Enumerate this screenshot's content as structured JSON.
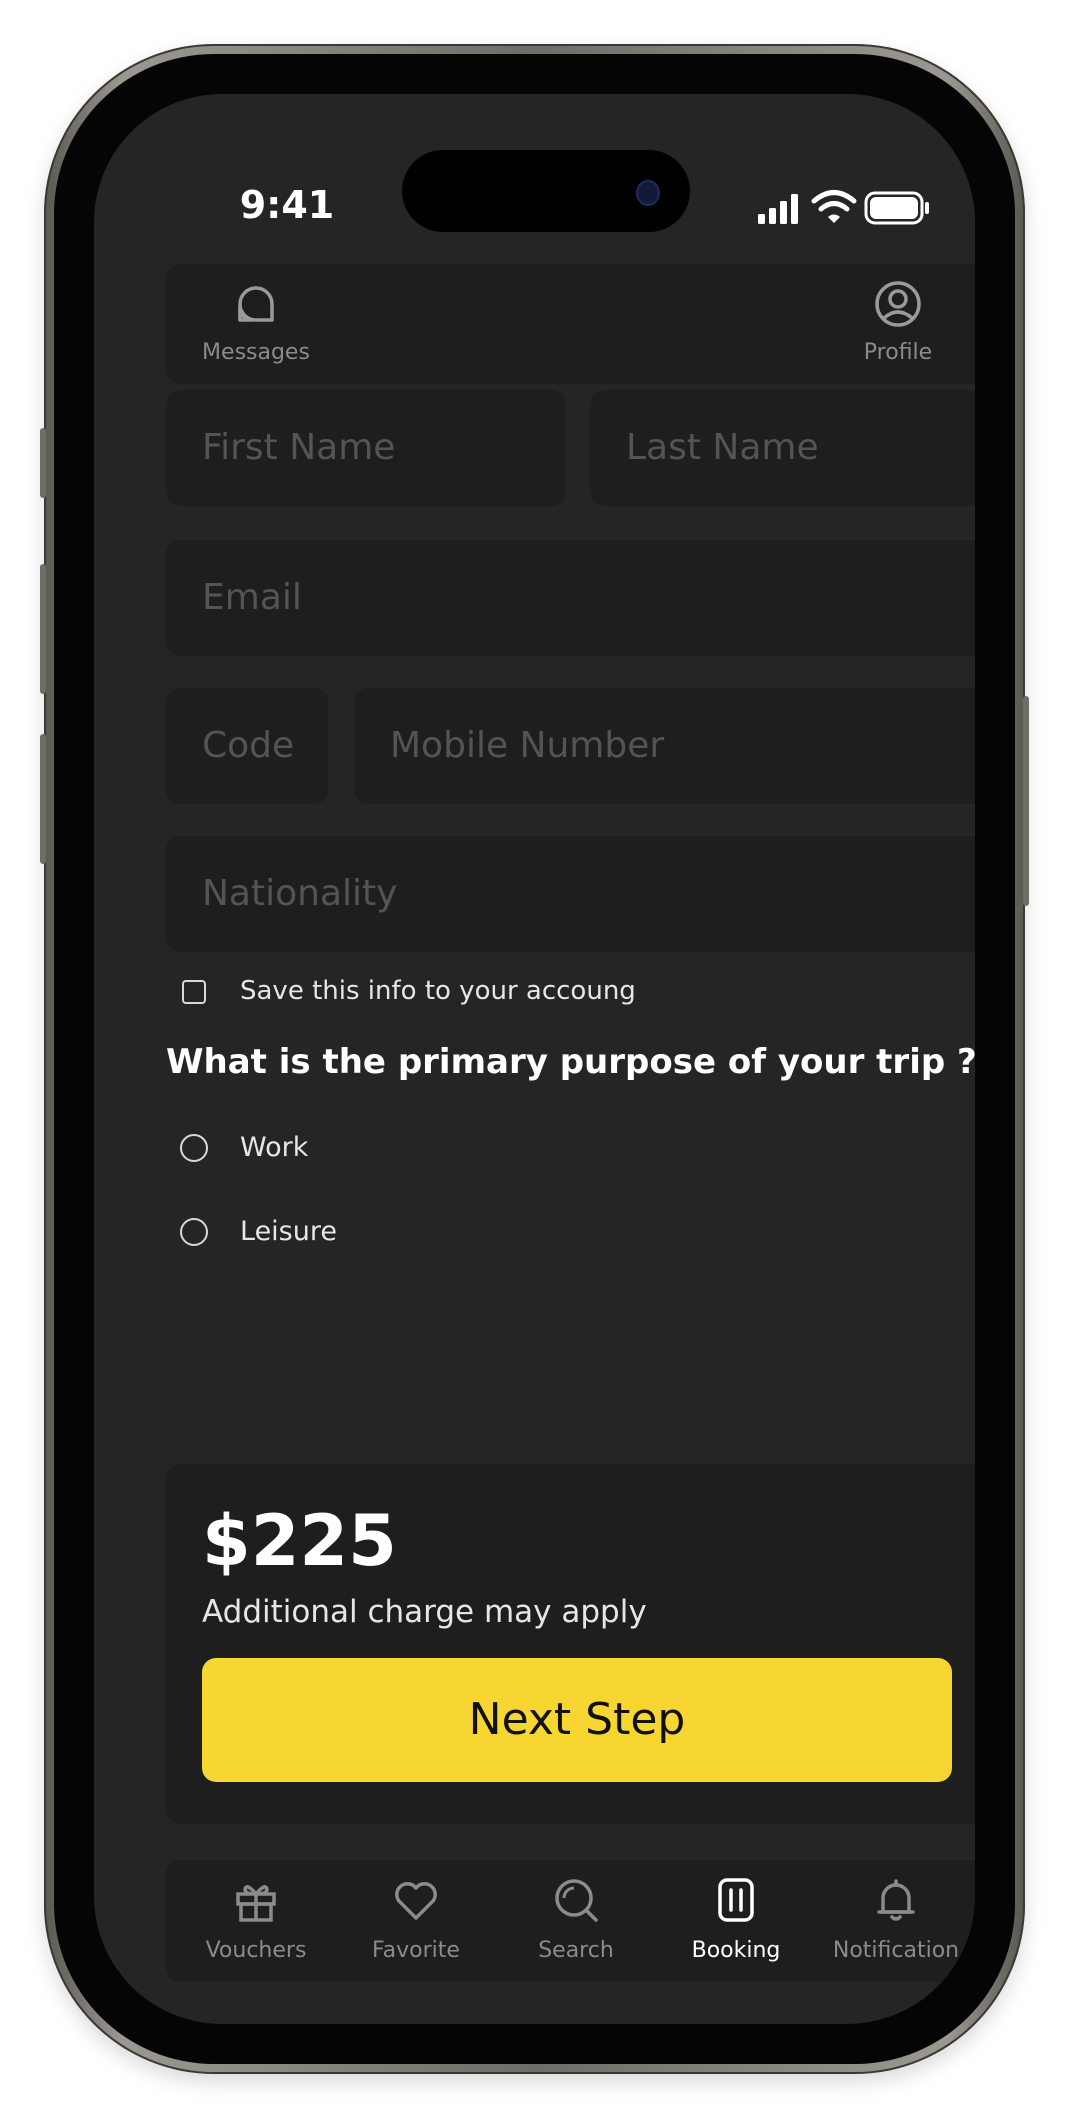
{
  "status_bar": {
    "time": "9:41"
  },
  "top_nav": {
    "messages_label": "Messages",
    "profile_label": "Profile",
    "messages_icon": "chat-bubbles-icon",
    "profile_icon": "user-circle-icon"
  },
  "form": {
    "first_name": {
      "placeholder": "First Name",
      "value": ""
    },
    "last_name": {
      "placeholder": "Last Name",
      "value": ""
    },
    "email": {
      "placeholder": "Email",
      "value": ""
    },
    "code": {
      "placeholder": "Code",
      "value": ""
    },
    "mobile": {
      "placeholder": "Mobile Number",
      "value": ""
    },
    "nationality": {
      "placeholder": "Nationality",
      "value": ""
    },
    "save_info": {
      "label": "Save this info to your accoung",
      "checked": false
    }
  },
  "trip_purpose": {
    "question": "What is the primary purpose of your trip ?",
    "options": [
      {
        "label": "Work",
        "selected": false
      },
      {
        "label": "Leisure",
        "selected": false
      }
    ]
  },
  "summary": {
    "price": "$225",
    "note": "Additional charge may apply",
    "button_label": "Next Step"
  },
  "bottom_nav": {
    "items": [
      {
        "label": "Vouchers",
        "icon": "gift-icon",
        "active": false
      },
      {
        "label": "Favorite",
        "icon": "heart-icon",
        "active": false
      },
      {
        "label": "Search",
        "icon": "search-icon",
        "active": false
      },
      {
        "label": "Booking",
        "icon": "luggage-icon",
        "active": true
      },
      {
        "label": "Notification",
        "icon": "bell-icon",
        "active": false
      }
    ]
  },
  "colors": {
    "background": "#252525",
    "card": "#1d1e1d",
    "accent": "#f8d631",
    "placeholder": "#545454",
    "muted_label": "#8b8b8b",
    "text": "#ffffff"
  }
}
